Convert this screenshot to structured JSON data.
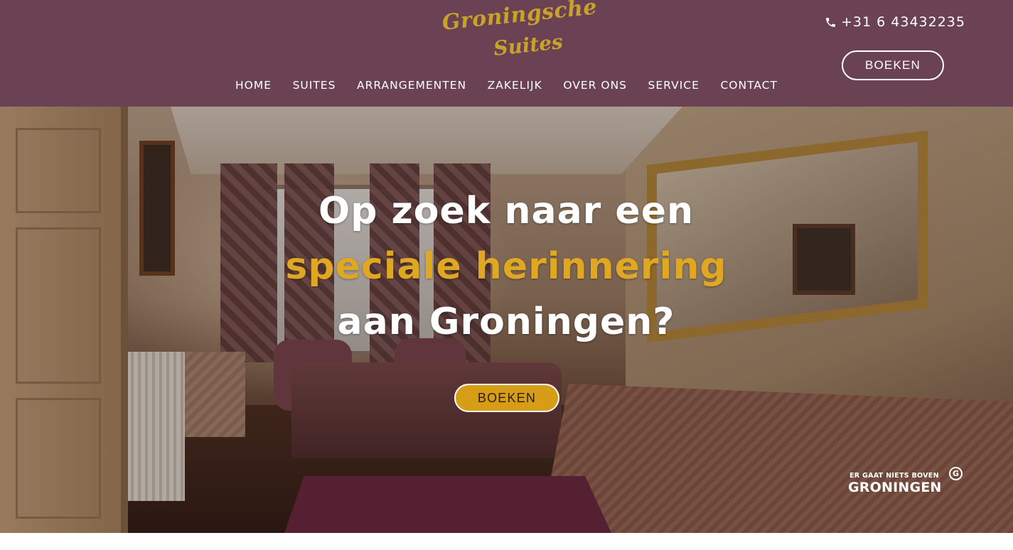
{
  "header": {
    "logo_line1": "Groningsche",
    "logo_line2": "Suites",
    "phone": "+31 6 43432235",
    "book_label": "BOEKEN",
    "nav": [
      {
        "label": "HOME"
      },
      {
        "label": "SUITES"
      },
      {
        "label": "ARRANGEMENTEN"
      },
      {
        "label": "ZAKELIJK"
      },
      {
        "label": "OVER ONS"
      },
      {
        "label": "SERVICE"
      },
      {
        "label": "CONTACT"
      }
    ]
  },
  "hero": {
    "line1": "Op zoek naar een",
    "line2": "speciale herinnering",
    "line3": "aan Groningen?",
    "book_label": "BOEKEN",
    "badge_small": "ER GAAT NIETS BOVEN",
    "badge_big": "GRONINGEN",
    "badge_mark": "G"
  },
  "colors": {
    "header_bg": "#6b4254",
    "logo_gold": "#c9a22a",
    "accent_gold": "#e0a722",
    "button_gold": "#d89d16",
    "text_white": "#ffffff"
  },
  "icons": {
    "phone": "phone-icon"
  }
}
